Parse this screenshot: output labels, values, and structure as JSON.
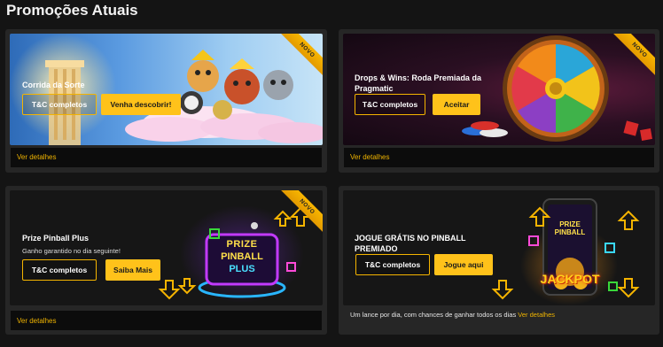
{
  "page": {
    "title": "Promoções Atuais"
  },
  "cards": [
    {
      "title": "Corrida da Sorte",
      "badge": "NOVO",
      "tc_label": "T&C completos",
      "cta_label": "Venha descobrir!",
      "footer_link": "Ver detalhes"
    },
    {
      "title": "Drops & Wins: Roda Premiada da Pragmatic",
      "badge": "NOVO",
      "tc_label": "T&C completos",
      "cta_label": "Aceitar",
      "footer_link": "Ver detalhes"
    },
    {
      "title": "Prize Pinball Plus",
      "subtitle": "Ganho garantido no dia seguinte!",
      "badge": "NOVO",
      "tc_label": "T&C completos",
      "cta_label": "Saiba Mais",
      "footer_link": "Ver detalhes",
      "art_text": [
        "PRIZE",
        "PINBALL",
        "PLUS"
      ]
    },
    {
      "title": "JOGUE GRÁTIS NO PINBALL PREMIADO",
      "tc_label": "T&C completos",
      "cta_label": "Jogue aqui",
      "note": "Um lance por dia, com chances de ganhar todos os dias",
      "note_link": "Ver detalhes",
      "art_text": [
        "PRIZE",
        "PINBALL",
        "JACKPOT"
      ]
    }
  ],
  "colors": {
    "accent": "#ffc21a",
    "background": "#141414",
    "card": "#262626"
  }
}
